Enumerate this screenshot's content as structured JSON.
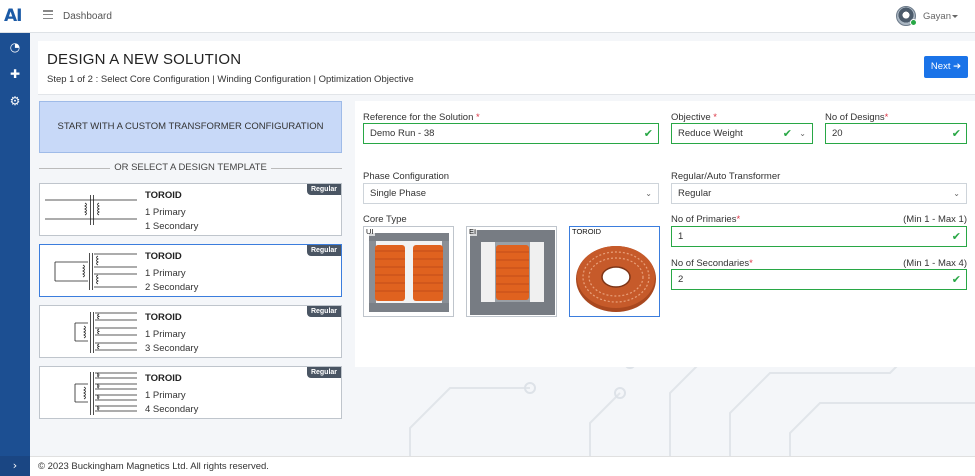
{
  "app": {
    "logo_text": "AI"
  },
  "topbar": {
    "breadcrumb": "Dashboard",
    "user_name": "Gayan"
  },
  "sidebar": {
    "items": [
      {
        "icon": "dashboard-gauge-icon",
        "glyph": "◔"
      },
      {
        "icon": "plus-icon",
        "glyph": "✚"
      },
      {
        "icon": "gear-settings-icon",
        "glyph": "⚙"
      }
    ],
    "expand_glyph": "›"
  },
  "page": {
    "title": "DESIGN A NEW SOLUTION",
    "subtitle": "Step 1 of 2 : Select Core Configuration | Winding Configuration | Optimization Objective",
    "next_label": "Next",
    "next_glyph": "➔"
  },
  "custom_config_label": "START WITH A CUSTOM TRANSFORMER CONFIGURATION",
  "or_select_label": "OR SELECT A DESIGN TEMPLATE",
  "templates": [
    {
      "name": "TOROID",
      "line1": "1 Primary",
      "line2": "1 Secondary",
      "badge": "Regular"
    },
    {
      "name": "TOROID",
      "line1": "1 Primary",
      "line2": "2 Secondary",
      "badge": "Regular"
    },
    {
      "name": "TOROID",
      "line1": "1 Primary",
      "line2": "3 Secondary",
      "badge": "Regular"
    },
    {
      "name": "TOROID",
      "line1": "1 Primary",
      "line2": "4 Secondary",
      "badge": "Regular"
    }
  ],
  "form": {
    "reference": {
      "label": "Reference for the Solution",
      "required": "*",
      "value": "Demo Run - 38"
    },
    "objective": {
      "label": "Objective",
      "required": "*",
      "value": "Reduce Weight"
    },
    "no_of_designs": {
      "label": "No of Designs",
      "required": "*",
      "value": "20"
    },
    "phase": {
      "label": "Phase Configuration",
      "value": "Single Phase"
    },
    "regular_auto": {
      "label": "Regular/Auto Transformer",
      "value": "Regular"
    },
    "core_type": {
      "label": "Core Type",
      "options": [
        "UI",
        "EI",
        "TOROID"
      ],
      "selected": "TOROID"
    },
    "primaries": {
      "label": "No of Primaries",
      "required": "*",
      "hint": "(Min 1 - Max 1)",
      "value": "1"
    },
    "secondaries": {
      "label": "No of Secondaries",
      "required": "*",
      "hint": "(Min 1 - Max 4)",
      "value": "2"
    }
  },
  "footer": {
    "copyright": "© 2023 Buckingham Magnetics Ltd. All rights reserved."
  },
  "colors": {
    "accent": "#1a73e8",
    "sidebar": "#1c4f92",
    "valid": "#28a745",
    "selected_border": "#3b7ddd",
    "custom_bg": "#c8d9f8"
  },
  "glyphs": {
    "check": "✔",
    "chevron": "⌄",
    "caret": "▾",
    "hamburger": "≡"
  }
}
